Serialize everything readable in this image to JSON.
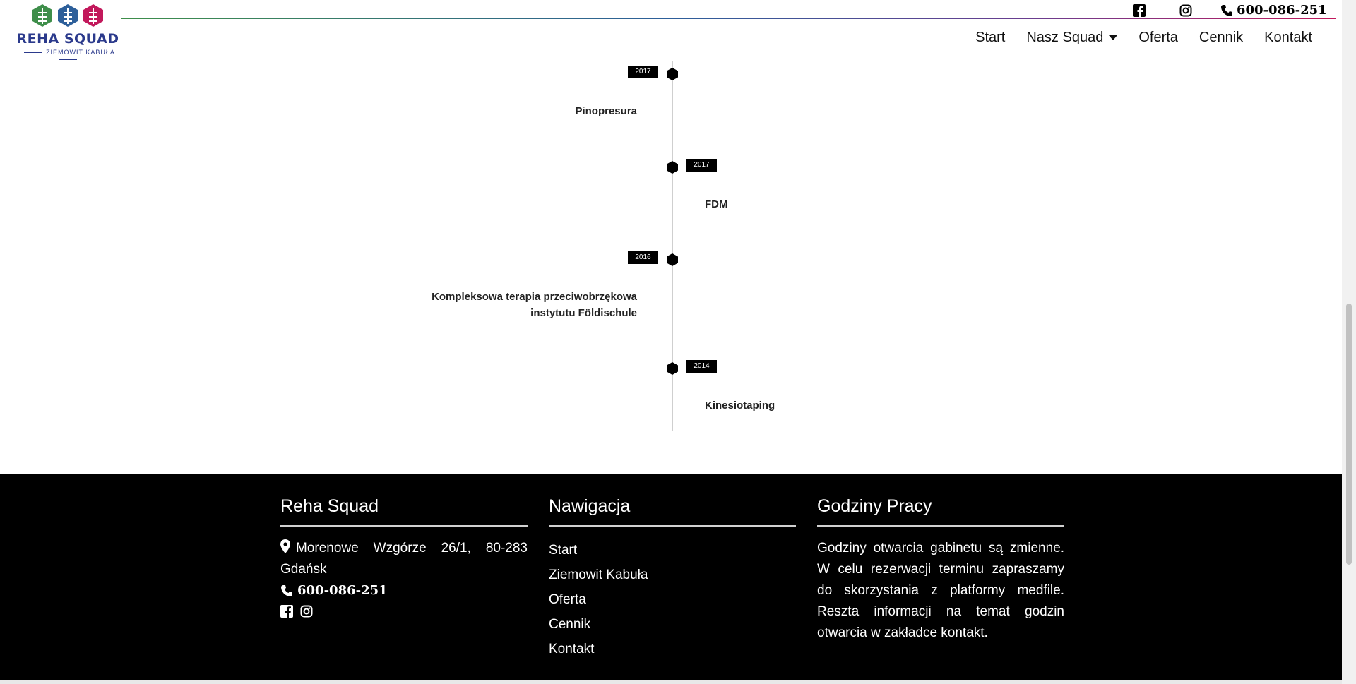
{
  "header": {
    "logo_title": "REHA SQUAD",
    "logo_subtitle": "ZIEMOWIT KABUŁA",
    "phone": "600-086-251",
    "nav": [
      "Start",
      "Nasz Squad",
      "Oferta",
      "Cennik",
      "Kontakt"
    ],
    "colors": {
      "green": "#3e8e4a",
      "blue": "#2d5f9a",
      "magenta": "#c2185b",
      "logo_text": "#2b3a8c"
    }
  },
  "timeline": [
    {
      "year": "2017",
      "title": "Pinopresura",
      "side": "left"
    },
    {
      "year": "2017",
      "title": "FDM",
      "side": "right"
    },
    {
      "year": "2016",
      "title_line1": "Kompleksowa terapia przeciwobrzękowa",
      "title_line2": "instytutu Földischule",
      "side": "left"
    },
    {
      "year": "2014",
      "title": "Kinesiotaping",
      "side": "right"
    }
  ],
  "footer": {
    "col1_heading": "Reha Squad",
    "address": "Morenowe Wzgórze 26/1, 80-283 Gdańsk",
    "phone": "600-086-251",
    "col2_heading": "Nawigacja",
    "nav": [
      "Start",
      "Ziemowit Kabuła",
      "Oferta",
      "Cennik",
      "Kontakt"
    ],
    "col3_heading": "Godziny Pracy",
    "hours_text": "Godziny otwarcia gabinetu są zmienne. W celu rezerwacji terminu zapraszamy do skorzystania z platformy medfile. Reszta informacji na temat godzin otwarcia w zakładce kontakt."
  }
}
